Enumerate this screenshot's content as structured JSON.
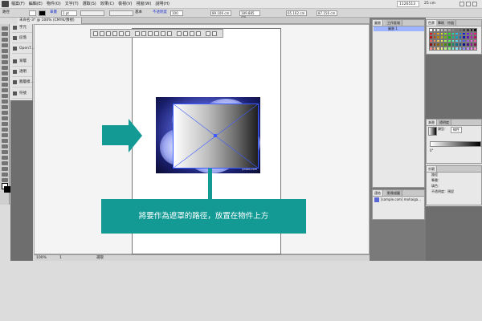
{
  "menubar": {
    "menus": [
      "檔案(F)",
      "編輯(E)",
      "物件(O)",
      "文字(T)",
      "選取(S)",
      "效果(C)",
      "檢視(V)",
      "視窗(W)",
      "說明(H)"
    ],
    "search_placeholder": "1126513",
    "zoom": "25 cm"
  },
  "ctrlbar": {
    "tool_label": "路徑",
    "stroke_label": "筆畫",
    "stroke_value": "1 pt",
    "style_label": "基本",
    "opacity_label": "不透明度",
    "opacity_value": "100",
    "x_value": "89.106 cm",
    "y_value": "189.885 cm",
    "w_value": "65.162 cm",
    "h_value": "87.156 cm"
  },
  "document_tab": "未命名-3* @ 100% (CMYK/預視)",
  "left_panel": {
    "items": [
      "字元",
      "段落",
      "OpenT...",
      "漸層",
      "透明",
      "圖層樣...",
      "符號"
    ]
  },
  "status": {
    "zoom": "100%",
    "page": "1",
    "mode": "選取"
  },
  "photo_caption": "photo.com",
  "callout_text": "將要作為遮罩的路徑，放置在物件上方",
  "layers_panel": {
    "tabs": [
      "圖層",
      "工作區域"
    ],
    "row": "圖層 1"
  },
  "swatch_panel": {
    "tabs": [
      "色票",
      "筆刷",
      "符號"
    ]
  },
  "gradient_panel": {
    "tabs": [
      "漸層",
      "透明度"
    ],
    "type_label": "類型：",
    "type_value": "線性",
    "angle_value": "0°"
  },
  "appearance_panel": {
    "tabs": [
      "外觀"
    ],
    "title": "路徑",
    "rows": [
      "筆畫：",
      "填色：",
      "不透明度：預設"
    ]
  },
  "links_panel": {
    "tabs": [
      "連結",
      "影像描圖"
    ],
    "row": "[sample.com] mohaiga..."
  },
  "colors": {
    "accent": "#139a95",
    "selection": "#3d5bff"
  }
}
